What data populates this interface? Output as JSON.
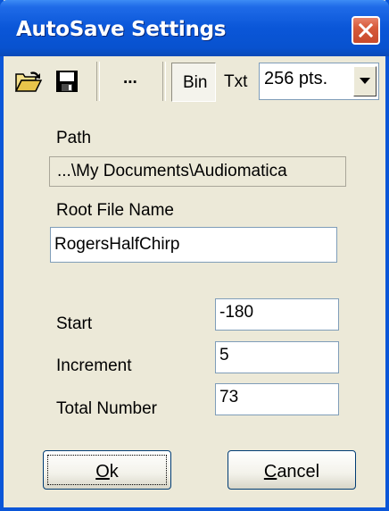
{
  "window": {
    "title": "AutoSave Settings"
  },
  "icons": {
    "close": "close-icon",
    "open": "open-folder-icon",
    "save": "floppy-disk-icon",
    "dropdown": "chevron-down-icon"
  },
  "toolbar": {
    "browse_label": "...",
    "bin_label": "Bin",
    "txt_label": "Txt",
    "points_value": "256 pts."
  },
  "form": {
    "path_label": "Path",
    "path_value": "...\\My Documents\\Audiomatica",
    "root_label": "Root File Name",
    "root_value": "RogersHalfChirp",
    "start_label": "Start",
    "start_value": "-180",
    "increment_label": "Increment",
    "increment_value": "5",
    "total_label": "Total Number",
    "total_value": "73"
  },
  "buttons": {
    "ok_mnemonic": "O",
    "ok_rest": "k",
    "cancel_mnemonic": "C",
    "cancel_rest": "ancel"
  },
  "colors": {
    "title_bar": "#0a56d8",
    "close_button": "#d65a3a",
    "dialog_background": "#ece9d8"
  }
}
